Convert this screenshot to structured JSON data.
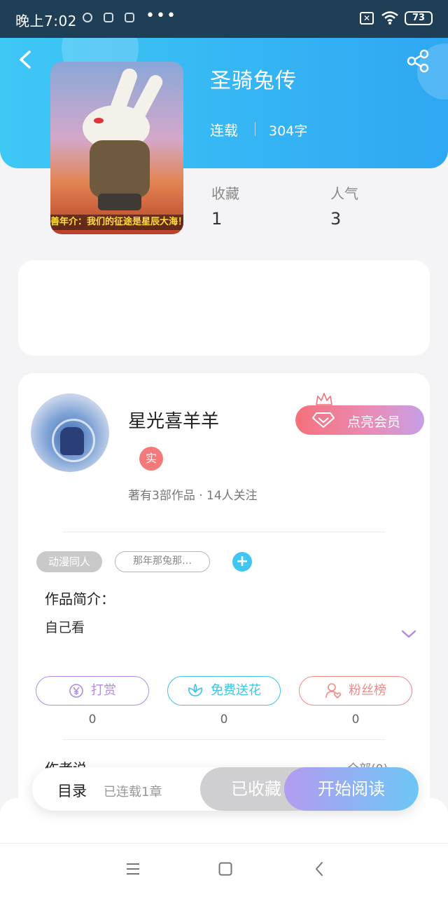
{
  "status_bar": {
    "time": "晚上7:02",
    "more": "•••",
    "sim_label": "✕",
    "battery": "73"
  },
  "book": {
    "title": "圣骑兔传",
    "status": "连载",
    "word_count": "304字",
    "cover_banner": "善年介：我们的征途是星辰大海！",
    "stats": [
      {
        "label": "收藏",
        "value": "1"
      },
      {
        "label": "人气",
        "value": "3"
      }
    ]
  },
  "author": {
    "name": "星光喜羊羊",
    "badge": "实",
    "meta": "著有3部作品 · 14人关注",
    "vip_button": "点亮会员"
  },
  "tags": {
    "category": "动漫同人",
    "custom": "那年那兔那…",
    "add": "+"
  },
  "intro": {
    "label": "作品简介：",
    "text": "自己看"
  },
  "actions": [
    {
      "label": "打赏",
      "count": "0",
      "color": "#b08de0"
    },
    {
      "label": "免费送花",
      "count": "0",
      "color": "#3dc4e6"
    },
    {
      "label": "粉丝榜",
      "count": "0",
      "color": "#ef8a8a"
    }
  ],
  "author_says": {
    "label": "作者说",
    "all_link": "全部(0)"
  },
  "bottom_bar": {
    "toc": "目录",
    "toc_meta": "已连载1章",
    "favorited": "已收藏",
    "read": "开始阅读"
  },
  "colors": {
    "header_start": "#3ec8f5",
    "header_end": "#2fa7f3",
    "accent_blue": "#3fc6f2",
    "vip_pink": "#f5717b"
  },
  "icons": {
    "back": "back-icon",
    "share": "share-icon",
    "expand": "chevron-down-icon",
    "nav": [
      "menu-icon",
      "home-icon",
      "back-nav-icon"
    ]
  }
}
